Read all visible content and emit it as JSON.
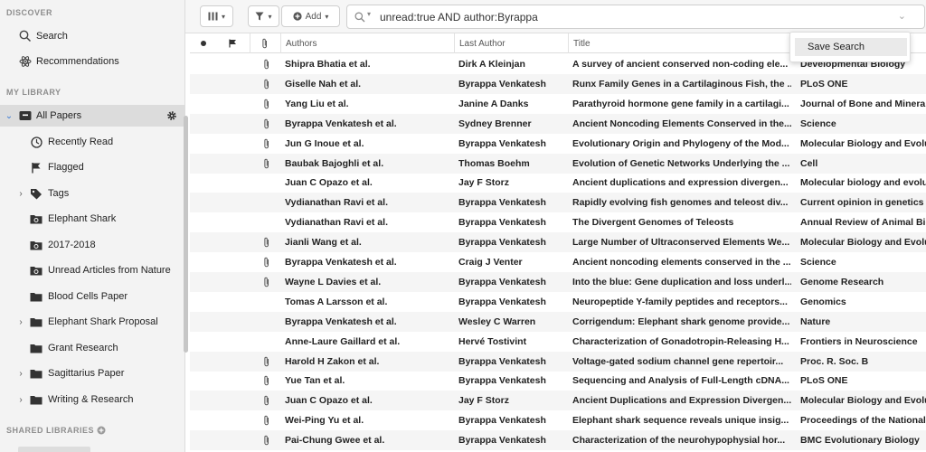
{
  "sidebar": {
    "discover_header": "DISCOVER",
    "search_label": "Search",
    "recommendations_label": "Recommendations",
    "library_header": "MY LIBRARY",
    "all_papers": "All Papers",
    "recently_read": "Recently Read",
    "flagged": "Flagged",
    "tags": "Tags",
    "collections": [
      {
        "label": "Elephant Shark",
        "icon": "smart-folder-icon",
        "expandable": false
      },
      {
        "label": "2017-2018",
        "icon": "smart-folder-icon",
        "expandable": false
      },
      {
        "label": "Unread Articles from Nature",
        "icon": "smart-folder-icon",
        "expandable": false
      },
      {
        "label": "Blood Cells Paper",
        "icon": "folder-icon",
        "expandable": false
      },
      {
        "label": "Elephant Shark Proposal",
        "icon": "folder-icon",
        "expandable": true
      },
      {
        "label": "Grant Research",
        "icon": "folder-icon",
        "expandable": false
      },
      {
        "label": "Sagittarius Paper",
        "icon": "folder-icon",
        "expandable": true
      },
      {
        "label": "Writing & Research",
        "icon": "folder-icon",
        "expandable": true
      }
    ],
    "shared_header": "SHARED LIBRARIES"
  },
  "toolbar": {
    "add_label": "Add",
    "search_query": "unread:true AND author:Byrappa"
  },
  "popup": {
    "save_search": "Save Search"
  },
  "table": {
    "headers": {
      "authors": "Authors",
      "last_author": "Last Author",
      "title": "Title"
    },
    "rows": [
      {
        "authors": "Shipra Bhatia et al.",
        "last": "Dirk A Kleinjan",
        "title": "A survey of ancient conserved non-coding ele...",
        "journal": "Developmental Biology",
        "attachment": true
      },
      {
        "authors": "Giselle Nah et al.",
        "last": "Byrappa Venkatesh",
        "title": "Runx Family Genes in a Cartilaginous Fish, the ...",
        "journal": "PLoS ONE",
        "attachment": true
      },
      {
        "authors": "Yang Liu et al.",
        "last": "Janine A Danks",
        "title": "Parathyroid hormone gene family in a cartilagi...",
        "journal": "Journal of Bone and Mineral",
        "attachment": true
      },
      {
        "authors": "Byrappa Venkatesh et al.",
        "last": "Sydney Brenner",
        "title": "Ancient Noncoding Elements Conserved in the...",
        "journal": "Science",
        "attachment": true
      },
      {
        "authors": "Jun G Inoue et al.",
        "last": "Byrappa Venkatesh",
        "title": "Evolutionary Origin and Phylogeny of the Mod...",
        "journal": "Molecular Biology and Evolu",
        "attachment": true
      },
      {
        "authors": "Baubak Bajoghli et al.",
        "last": "Thomas Boehm",
        "title": "Evolution of Genetic Networks Underlying the ...",
        "journal": "Cell",
        "attachment": true
      },
      {
        "authors": "Juan C Opazo et al.",
        "last": "Jay F Storz",
        "title": "Ancient duplications and expression divergen...",
        "journal": "Molecular biology and evolu",
        "attachment": false
      },
      {
        "authors": "Vydianathan Ravi et al.",
        "last": "Byrappa Venkatesh",
        "title": "Rapidly evolving fish genomes and teleost div...",
        "journal": "Current opinion in genetics",
        "attachment": false
      },
      {
        "authors": "Vydianathan Ravi et al.",
        "last": "Byrappa Venkatesh",
        "title": "The Divergent Genomes of Teleosts",
        "journal": "Annual Review of Animal Bio",
        "attachment": false
      },
      {
        "authors": "Jianli Wang et al.",
        "last": "Byrappa Venkatesh",
        "title": "Large Number of Ultraconserved Elements We...",
        "journal": "Molecular Biology and Evolu",
        "attachment": true
      },
      {
        "authors": "Byrappa Venkatesh et al.",
        "last": "Craig J Venter",
        "title": "Ancient noncoding elements conserved in the ...",
        "journal": "Science",
        "attachment": true
      },
      {
        "authors": "Wayne L Davies et al.",
        "last": "Byrappa Venkatesh",
        "title": "Into the blue: Gene duplication and loss underl...",
        "journal": "Genome Research",
        "attachment": true
      },
      {
        "authors": "Tomas A Larsson et al.",
        "last": "Byrappa Venkatesh",
        "title": "Neuropeptide Y-family peptides and receptors...",
        "journal": "Genomics",
        "attachment": false
      },
      {
        "authors": "Byrappa Venkatesh et al.",
        "last": "Wesley C Warren",
        "title": "Corrigendum: Elephant shark genome provide...",
        "journal": "Nature",
        "attachment": false
      },
      {
        "authors": "Anne-Laure Gaillard et al.",
        "last": "Hervé Tostivint",
        "title": "Characterization of Gonadotropin-Releasing H...",
        "journal": "Frontiers in Neuroscience",
        "attachment": false
      },
      {
        "authors": "Harold H Zakon et al.",
        "last": "Byrappa Venkatesh",
        "title": "Voltage-gated sodium channel gene repertoir...",
        "journal": "Proc. R. Soc. B",
        "attachment": true
      },
      {
        "authors": "Yue Tan et al.",
        "last": "Byrappa Venkatesh",
        "title": "Sequencing and Analysis of Full-Length cDNA...",
        "journal": "PLoS ONE",
        "attachment": true
      },
      {
        "authors": "Juan C Opazo et al.",
        "last": "Jay F Storz",
        "title": "Ancient Duplications and Expression Divergen...",
        "journal": "Molecular Biology and Evolu",
        "attachment": true
      },
      {
        "authors": "Wei-Ping Yu et al.",
        "last": "Byrappa Venkatesh",
        "title": "Elephant shark sequence reveals unique insig...",
        "journal": "Proceedings of the National",
        "attachment": true
      },
      {
        "authors": "Pai-Chung Gwee et al.",
        "last": "Byrappa Venkatesh",
        "title": "Characterization of the neurohypophysial hor...",
        "journal": "BMC Evolutionary Biology",
        "attachment": true
      }
    ]
  }
}
